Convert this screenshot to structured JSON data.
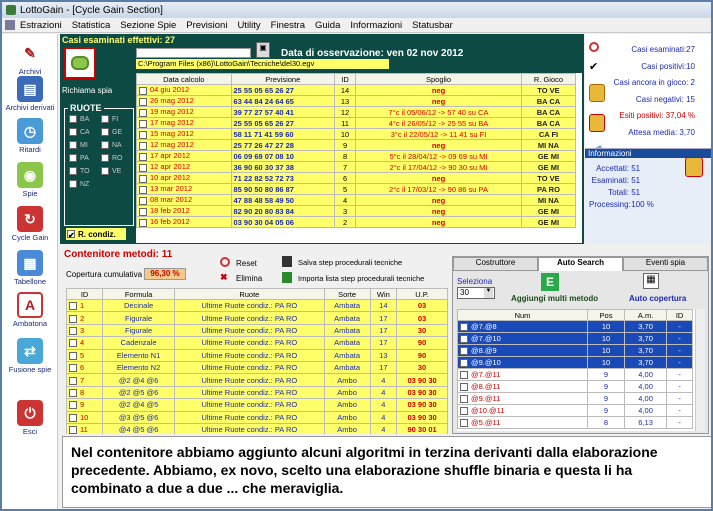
{
  "window": {
    "title": "LottoGain - [Cycle Gain Section]"
  },
  "menu": [
    "Estrazioni",
    "Statistica",
    "Sezione Spie",
    "Previsioni",
    "Utility",
    "Finestra",
    "Guida",
    "Informazioni",
    "Statusbar"
  ],
  "sidebar": [
    {
      "label": "Archivi",
      "icon": "pencil-icon"
    },
    {
      "label": "Archivi derivati",
      "icon": "book-icon"
    },
    {
      "label": "Ritardi",
      "icon": "clock-icon"
    },
    {
      "label": "Spie",
      "icon": "pill-icon"
    },
    {
      "label": "Cycle Gain",
      "icon": "cycle-icon"
    },
    {
      "label": "Tabellone",
      "icon": "calendar-icon"
    },
    {
      "label": "Ambatona",
      "icon": "a-icon"
    },
    {
      "label": "Fusione spie",
      "icon": "merge-icon"
    },
    {
      "label": "Esci",
      "icon": "exit-icon"
    }
  ],
  "top": {
    "casi_label": "Casi esaminati effettivi: 27",
    "richiama": "Richiama spia",
    "path": "C:\\Program Files (x86)\\LottoGain\\Tecniche\\del30.egv",
    "data_oss": "Data di osservazione:  ven 02 nov 2012",
    "ruote_title": "RUOTE",
    "ruote": [
      "BA",
      "FI",
      "CA",
      "GE",
      "MI",
      "NA",
      "PA",
      "RO",
      "TO",
      "VE",
      "NZ"
    ],
    "rcond": "R. condiz."
  },
  "cols": [
    "Data calcolo",
    "Previsione",
    "ID",
    "Spoglio",
    "R. Gioco"
  ],
  "rows": [
    [
      "04 giu 2012",
      "25 55 05 65 26 27",
      "14",
      "neg",
      "TO VE"
    ],
    [
      "26 mag 2012",
      "63 44 84 24 64 65",
      "13",
      "neg",
      "BA CA"
    ],
    [
      "19 mag 2012",
      "39 77 27 57 40 41",
      "12",
      "7°c il 05/06/12 -> 57 40 su CA",
      "BA CA"
    ],
    [
      "17 mag 2012",
      "25 55 05 65 26 27",
      "11",
      "4°c il 26/05/12 -> 25 55 su BA",
      "BA CA"
    ],
    [
      "15 mag 2012",
      "58 11 71 41 59 60",
      "10",
      "3°c il 22/05/12 -> 11 41 su FI",
      "CA FI"
    ],
    [
      "12 mag 2012",
      "25 77 26 47 27 28",
      "9",
      "neg",
      "MI NA"
    ],
    [
      "17 apr 2012",
      "06 09 69 07 08 10",
      "8",
      "5°c il 28/04/12 -> 09 69 su MI",
      "GE MI"
    ],
    [
      "12 apr 2012",
      "36 90 60 30 37 38",
      "7",
      "2°c il 17/04/12 -> 90 30 su MI",
      "GE MI"
    ],
    [
      "10 apr 2012",
      "71 22 82 52 72 73",
      "6",
      "neg",
      "TO VE"
    ],
    [
      "13 mar 2012",
      "85 90 50 80 86 87",
      "5",
      "2°c il 17/03/12 -> 90 86 su PA",
      "PA RO"
    ],
    [
      "08 mar 2012",
      "47 88 48 58 49 50",
      "4",
      "neg",
      "MI NA"
    ],
    [
      "18 feb 2012",
      "82 90 20 80 83 84",
      "3",
      "neg",
      "GE MI"
    ],
    [
      "16 feb 2012",
      "03 90 30 04 05 06",
      "2",
      "neg",
      "GE MI"
    ]
  ],
  "info": {
    "esaminati": "Casi esaminati:27",
    "positivi": "Casi positivi:10",
    "ancora": "Casi ancora in gioco: 2",
    "negativi": "Casi negativi: 15",
    "esiti": "Esiti positivi: 37,04 %",
    "attesa": "Attesa media: 3,70",
    "info_title": "Informazioni",
    "accettati": "Accettati:",
    "acc_v": "51",
    "esam": "Esaminati:",
    "esam_v": "51",
    "totali": "Totali:",
    "tot_v": "51",
    "processing": "Processing:",
    "proc_v": "100 %"
  },
  "metodi": {
    "title": "Contenitore metodi: 11",
    "copertura": "Copertura cumulativa",
    "cop_v": "96,30 %",
    "reset": "Reset",
    "elimina": "Elimina",
    "salva": "Salva step procedurali tecniche",
    "importa": "Importa lista step procedurali tecniche",
    "cols": [
      "ID",
      "Formula",
      "Ruote",
      "Sorte",
      "Win",
      "U.P."
    ],
    "rows": [
      [
        "1",
        "Decinale",
        "Ultime Ruote condiz.: PA RO",
        "Ambata",
        "14",
        "03"
      ],
      [
        "2",
        "Figurale",
        "Ultime Ruote condiz.: PA RO",
        "Ambata",
        "17",
        "03"
      ],
      [
        "3",
        "Figurale",
        "Ultime Ruote condiz.: PA RO",
        "Ambata",
        "17",
        "30"
      ],
      [
        "4",
        "Cadenzale",
        "Ultime Ruote condiz.: PA RO",
        "Ambata",
        "17",
        "90"
      ],
      [
        "5",
        "Elemento N1",
        "Ultime Ruote condiz.: PA RO",
        "Ambata",
        "13",
        "90"
      ],
      [
        "6",
        "Elemento N2",
        "Ultime Ruote condiz.: PA RO",
        "Ambata",
        "17",
        "30"
      ],
      [
        "7",
        "@2 @4 @6",
        "Ultime Ruote condiz.: PA RO",
        "Ambo",
        "4",
        "03 90 30"
      ],
      [
        "8",
        "@2 @5 @6",
        "Ultime Ruote condiz.: PA RO",
        "Ambo",
        "4",
        "03 90 30"
      ],
      [
        "9",
        "@2 @4 @5",
        "Ultime Ruote condiz.: PA RO",
        "Ambo",
        "4",
        "03 90 30"
      ],
      [
        "10",
        "@3 @5 @6",
        "Ultime Ruote condiz.: PA RO",
        "Ambo",
        "4",
        "03 90 30"
      ],
      [
        "11",
        "@4 @5 @6",
        "Ultime Ruote condiz.: PA RO",
        "Ambo",
        "4",
        "90 30 01"
      ]
    ]
  },
  "tabs": [
    "Costruttore",
    "Auto Search",
    "Eventi spia"
  ],
  "autosearch": {
    "seleziona": "Seleziona",
    "sel_v": "30",
    "aggiungi": "Aggiungi multi metodo",
    "copertura": "Auto copertura",
    "cols": [
      "Num",
      "Pos",
      "A.m.",
      "ID"
    ],
    "rows": [
      [
        "@7.@8",
        "10",
        "3,70",
        "-"
      ],
      [
        "@7.@10",
        "10",
        "3,70",
        "-"
      ],
      [
        "@8.@9",
        "10",
        "3,70",
        "-"
      ],
      [
        "@9.@10",
        "10",
        "3,70",
        "-"
      ],
      [
        "@7.@11",
        "9",
        "4,00",
        "-"
      ],
      [
        "@8.@11",
        "9",
        "4,00",
        "-"
      ],
      [
        "@9.@11",
        "9",
        "4,00",
        "-"
      ],
      [
        "@10.@11",
        "9",
        "4,00",
        "-"
      ],
      [
        "@5.@11",
        "8",
        "6,13",
        "-"
      ]
    ]
  },
  "caption": "Nel contenitore abbiamo aggiunto alcuni algoritmi in terzina derivanti dalla elaborazione precedente. Abbiamo, ex novo, scelto una elaborazione shuffle binaria e questa li ha combinato a due a due ... che meraviglia.",
  "colors": {
    "accent": "#0d4a43",
    "yellow": "#ffff6a",
    "red": "#d00000"
  }
}
